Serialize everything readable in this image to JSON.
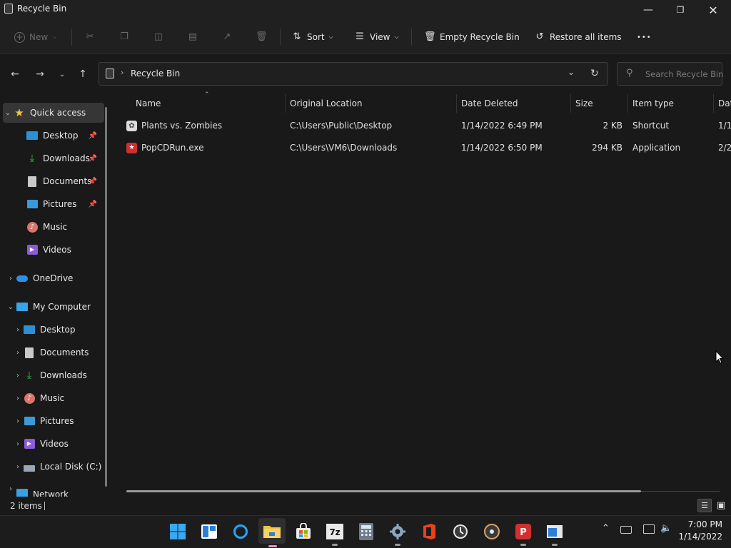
{
  "window": {
    "title": "Recycle Bin"
  },
  "toolbar": {
    "new_label": "New",
    "sort_label": "Sort",
    "view_label": "View",
    "empty_label": "Empty Recycle Bin",
    "restore_label": "Restore all items",
    "more_label": "•••"
  },
  "address": {
    "crumb": "Recycle Bin",
    "search_placeholder": "Search Recycle Bin"
  },
  "sidebar": {
    "quick_access": "Quick access",
    "qa_items": [
      "Desktop",
      "Downloads",
      "Documents",
      "Pictures",
      "Music",
      "Videos"
    ],
    "onedrive": "OneDrive",
    "my_computer": "My Computer",
    "mc_items": [
      "Desktop",
      "Documents",
      "Downloads",
      "Music",
      "Pictures",
      "Videos",
      "Local Disk (C:)"
    ],
    "network": "Network"
  },
  "columns": {
    "name": "Name",
    "original_location": "Original Location",
    "date_deleted": "Date Deleted",
    "size": "Size",
    "item_type": "Item type",
    "date_partial": "Dat"
  },
  "files": [
    {
      "name": "Plants vs. Zombies",
      "location": "C:\\Users\\Public\\Desktop",
      "date": "1/14/2022 6:49 PM",
      "size": "2 KB",
      "type": "Shortcut",
      "date_mod": "1/1"
    },
    {
      "name": "PopCDRun.exe",
      "location": "C:\\Users\\VM6\\Downloads",
      "date": "1/14/2022 6:50 PM",
      "size": "294 KB",
      "type": "Application",
      "date_mod": "2/2"
    }
  ],
  "status": {
    "count": "2 items"
  },
  "clock": {
    "time": "7:00 PM",
    "date": "1/14/2022"
  },
  "colors": {
    "accent": "#0a84ff",
    "folder": "#f5c342"
  }
}
